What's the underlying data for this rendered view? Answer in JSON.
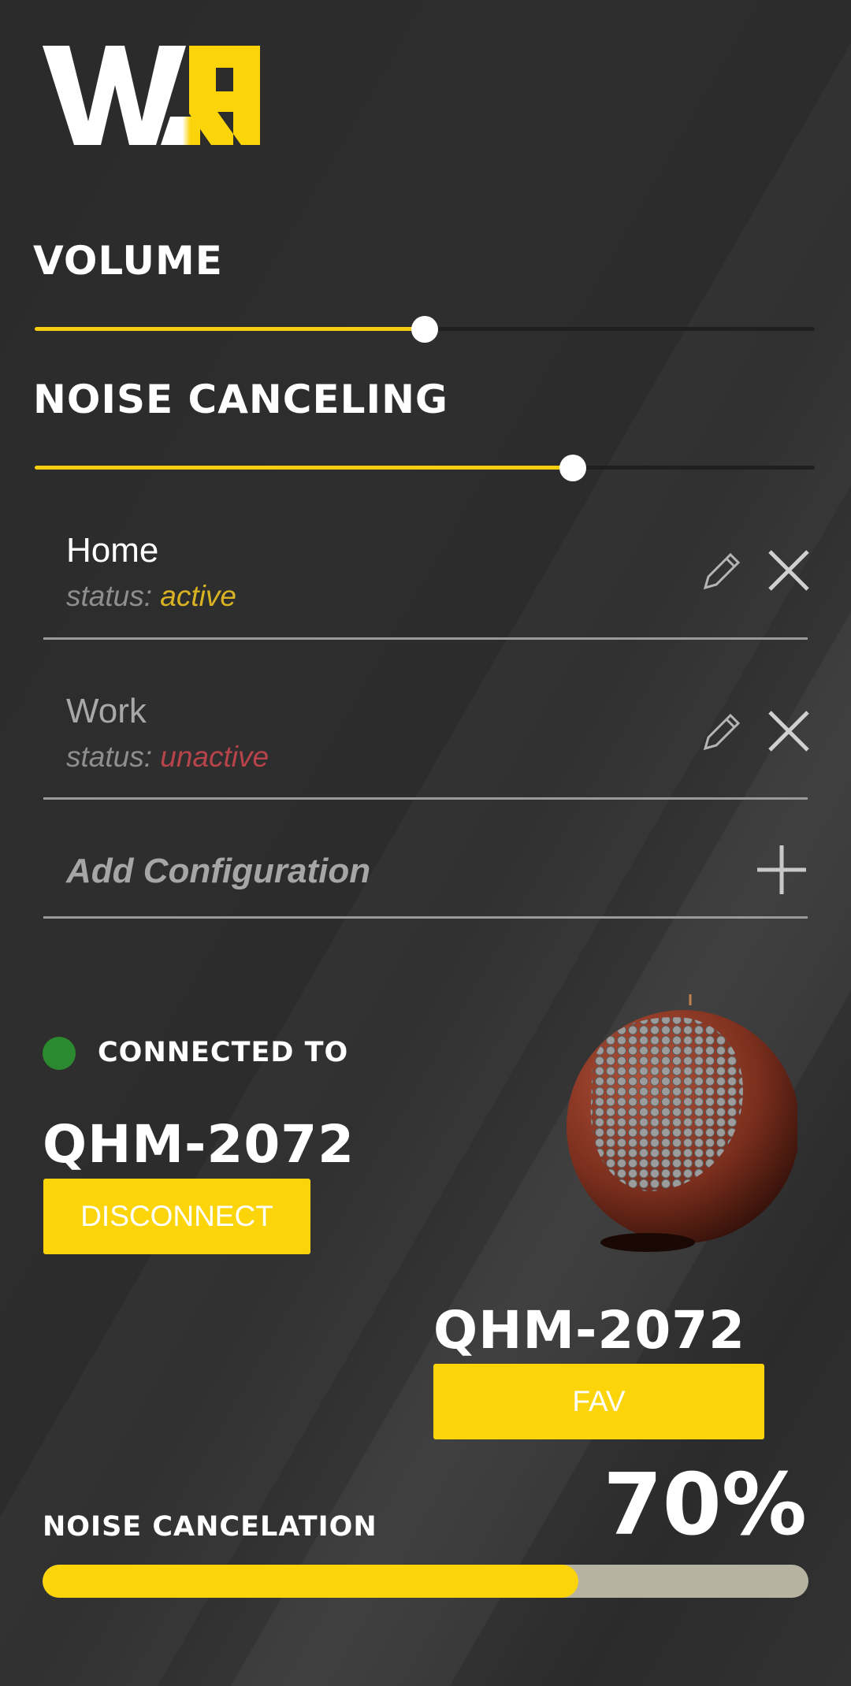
{
  "brand": {
    "logo_text": "WLR",
    "accent": "#fcd40a"
  },
  "volume": {
    "title": "VOLUME",
    "value_percent": 50
  },
  "noise_canceling": {
    "title": "NOISE CANCELING",
    "value_percent": 69
  },
  "configurations": [
    {
      "name": "Home",
      "status_label": "status:",
      "status": "active",
      "status_color": "#d9b322"
    },
    {
      "name": "Work",
      "status_label": "status:",
      "status": "unactive",
      "status_color": "#b8444b"
    }
  ],
  "add_configuration": {
    "label": "Add Configuration"
  },
  "connection": {
    "label": "CONNECTED TO",
    "device": "QHM-2072",
    "disconnect_label": "DISCONNECT",
    "status_color": "#2b8a2f"
  },
  "favorite": {
    "device": "QHM-2072",
    "fav_label": "FAV"
  },
  "noise_cancelation": {
    "label": "NOISE CANCELATION",
    "percent_text": "70%",
    "value_percent": 70
  },
  "icons": [
    "pencil-icon",
    "close-icon",
    "plus-icon",
    "speaker-image"
  ]
}
